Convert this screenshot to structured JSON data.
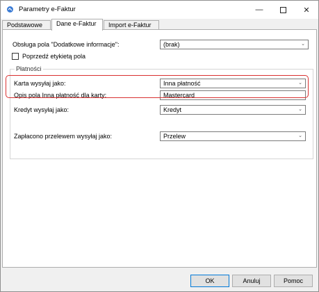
{
  "window": {
    "title": "Parametry e-Faktur",
    "minimize_icon": "minimize-icon",
    "maximize_icon": "maximize-icon",
    "close_icon": "close-icon"
  },
  "tabs": [
    {
      "label": "Podstawowe",
      "active": false
    },
    {
      "label": "Dane e-Faktur",
      "active": true
    },
    {
      "label": "Import e-Faktur",
      "active": false
    }
  ],
  "form": {
    "additional_info_label": "Obsługa pola \"Dodatkowe informacje\":",
    "additional_info_value": "(brak)",
    "prefix_label_checkbox": "Poprzedź etykietą pola",
    "prefix_label_checked": false,
    "payments_group_title": "Płatności",
    "card_label": "Karta wysyłaj jako:",
    "card_value": "Inna płatność",
    "card_desc_label": "Opis pola Inna płatność dla karty:",
    "card_desc_value": "Mastercard",
    "credit_label": "Kredyt wysyłaj jako:",
    "credit_value": "Kredyt",
    "transfer_label": "Zapłacono przelewem wysyłaj jako:",
    "transfer_value": "Przelew"
  },
  "buttons": {
    "ok": "OK",
    "cancel": "Anuluj",
    "help": "Pomoc"
  },
  "colors": {
    "highlight": "#d93030",
    "default_button_border": "#0078d7"
  }
}
